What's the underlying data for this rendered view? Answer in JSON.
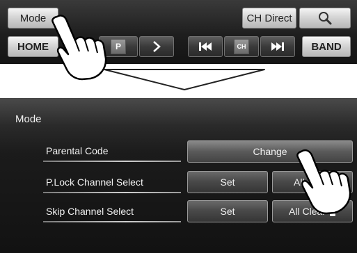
{
  "top_bar": {
    "mode_label": "Mode",
    "ch_direct_label": "CH Direct",
    "home_label": "HOME",
    "band_label": "BAND",
    "preset_badge": "P",
    "ch_badge": "CH",
    "icons": [
      "search-icon",
      "next-arrow-icon",
      "skip-back-icon",
      "skip-forward-icon"
    ]
  },
  "mode_screen": {
    "title": "Mode",
    "rows": [
      {
        "label": "Parental Code",
        "buttons": [
          "Change"
        ]
      },
      {
        "label": "P.Lock Channel Select",
        "buttons": [
          "Set",
          "All C"
        ]
      },
      {
        "label": "Skip Channel Select",
        "buttons": [
          "Set",
          "All Clear"
        ]
      }
    ]
  },
  "colors": {
    "bar_dark": "#1e1e1e",
    "button_light": "#e0e0e0",
    "screen_bg": "#1b1b1b"
  }
}
